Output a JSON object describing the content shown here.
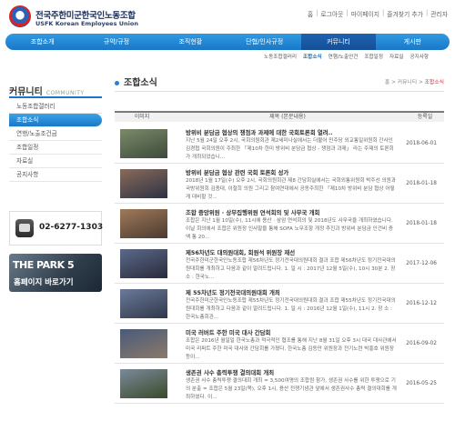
{
  "header": {
    "org_name_kr": "전국주한미군한국인노동조합",
    "org_name_en": "USFK Korean Employees Union",
    "util_links": [
      "홈",
      "로그아웃",
      "마이페이지",
      "즐겨찾기 추가",
      "관리자"
    ]
  },
  "nav": {
    "items": [
      "조합소개",
      "규약/규정",
      "조직현황",
      "단협/인사규정",
      "커뮤니티",
      "게시판"
    ],
    "active_index": 4,
    "sub_items": [
      "노동조합갤러리",
      "조합소식",
      "연행/노출안건",
      "조합일정",
      "자료실",
      "공지사항"
    ],
    "sub_active_index": 1
  },
  "sidebar": {
    "title_kr": "커뮤니티",
    "title_en": "COMMUNITY",
    "items": [
      "노동조합갤러리",
      "조합소식",
      "연행/노출조건금",
      "조합일정",
      "자료실",
      "공지사항"
    ],
    "active_index": 1,
    "phone": "02-6277-1303",
    "banner_line1": "THE PARK 5",
    "banner_line2": "홈페이지 바로가기"
  },
  "content": {
    "page_title": "조합소식",
    "breadcrumb": [
      "홈",
      "커뮤니티",
      "조합소식"
    ],
    "columns": [
      "이미지",
      "제목 (본문내용)",
      "등록일"
    ],
    "rows": [
      {
        "title": "방위비 분담금 협상의 쟁점과 과제에 대한 국회토론회 열려..",
        "desc": "지난 5월 24일 오후 2시, 국회의원회관 제2세미나실에서는 더불어 민주당 외교통일위원회 간사인 김경협 국회의원이 주최한 「제10차 한미 방위비 분담금 협상 - 쟁점과 과제」 라는 주제의 토론회가 개최되었습니...",
        "date": "2018-06-01",
        "colors": [
          "#7b8a6a",
          "#3c4a3a"
        ]
      },
      {
        "title": "방위비 분담금 협상 관련 국회 토론회 성가",
        "desc": "2018년 1월 17일(수) 오후 2시, 국회의원회관 제8 간담회실에서는 국회외통위원회 박주선 의원과 국방위원회 김종대, 이철희 의원 그리고 참여연대에서 공동주최한 「제10차 방위비 분담 협상 어떻게 대비할 것...",
        "date": "2018-01-18",
        "colors": [
          "#8a6a5a",
          "#2c3344"
        ]
      },
      {
        "title": "조합 중앙위원 · 상무집행위원 연석회의 및 사무국 개회",
        "desc": "조합은 지난 1월 10일(수), 11시에 용산 · 삼암 연석회의 및 2018년도 사무국을 개최하였습니다. 이날 회의에서 조합은 위원장 인사말을 통해 SOFA 노무조항 개정 추진과 방위비 분담금 인건비 증액 통 20...",
        "date": "2018-01-18",
        "colors": [
          "#a07a5a",
          "#4a3a30"
        ]
      },
      {
        "title": "제56차년도 대의원대회, 회원석 위원장 재선",
        "desc": "전국주한미군한국인노동조합 제56차년도 정기전국대의원대회 결과 조합 제56차년도 정기전국대의원대회를 개최하고 다음과 같이 알려드립니다. 1. 일 시 : 2017년 12월 5일(수), 10시 30분 2. 장 소 : 한국노...",
        "date": "2017-12-06",
        "colors": [
          "#5a6a8a",
          "#2a2a3a"
        ]
      },
      {
        "title": "제 55차년도 정기전국대의원대회 개최",
        "desc": "전국주한미군한국인노동조합 제55차년도 정기전국대의원대회 결과 조합 제55차년도 정기전국대의원대회를 개최하고 다음과 같이 알려드립니다. 1. 일 시 : 2016년 12월 1일(수), 11시 2. 장 소 : 한국노총회관...",
        "date": "2016-12-12",
        "colors": [
          "#6a7a9a",
          "#30384a"
        ]
      },
      {
        "title": "미국 러버트 주한 미국 대사 간담회",
        "desc": "조합은 2016년 월일일 한국노총과 적극적인 협조를 통해 지난 8월 31일 오후 3시 대국 대사관에서 미국 리퍼트 주한 미국 대사와 간담회를 가졌다. 한국노총 김동만 위원장과 전기노련 박홍호 위원장 등이...",
        "date": "2016-09-02",
        "colors": [
          "#4a5a7a",
          "#8a7a6a"
        ]
      },
      {
        "title": "생존권 사수 총력투쟁 결의대회 개최",
        "desc": "생존권 사수 총력투쟁 결의대회 개최 = 3,500여명의 조합원 참가, 생존권 사수를 위한 투쟁으로 기의 분출 = 조합은 5월 23일(목), 오후 1시, 용산 전쟁기념관 앞에서 생존권사수 총력 결의대회를 개최하였다. 이...",
        "date": "2016-05-25",
        "colors": [
          "#7a8a9a",
          "#3a4a2a"
        ]
      }
    ]
  }
}
